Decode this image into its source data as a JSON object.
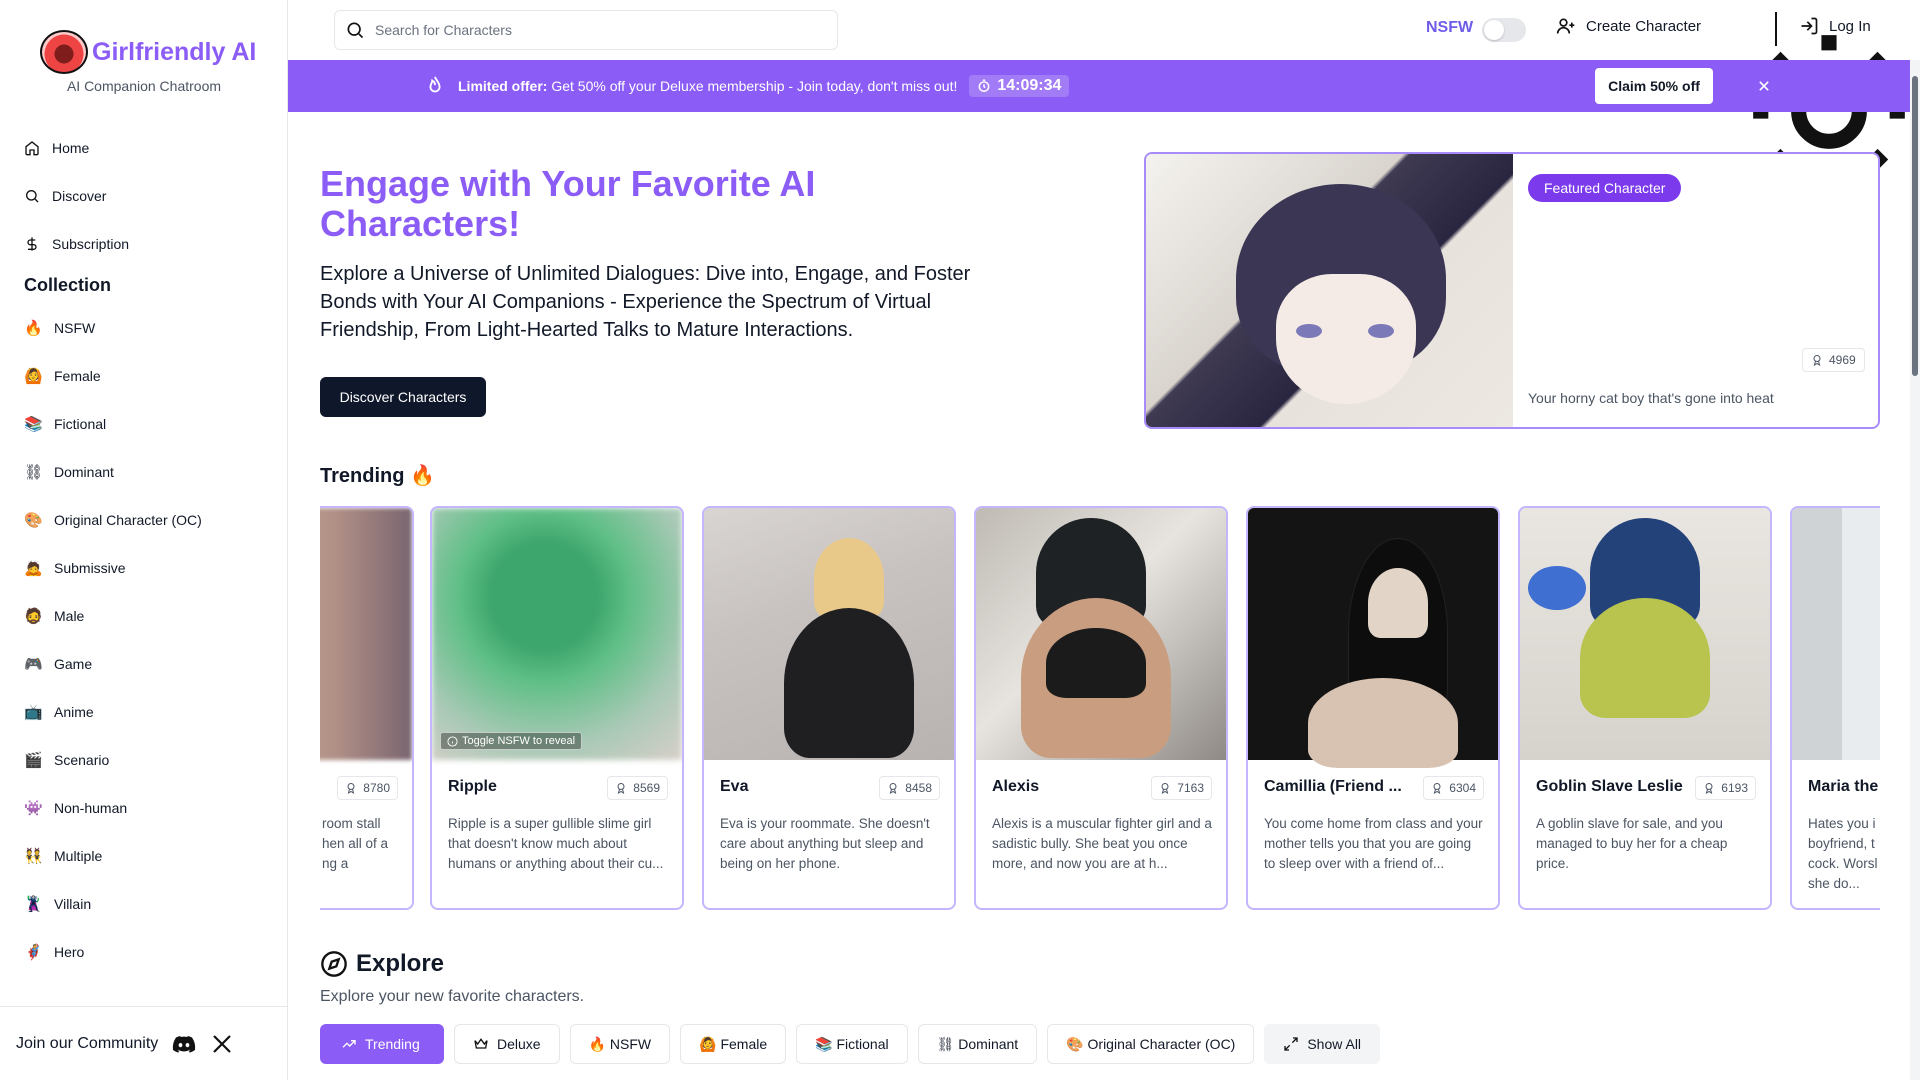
{
  "brand": {
    "name": "Girlfriendly AI",
    "tagline": "AI Companion Chatroom"
  },
  "nav": [
    {
      "label": "Home",
      "icon": "home-icon"
    },
    {
      "label": "Discover",
      "icon": "search-icon"
    },
    {
      "label": "Subscription",
      "icon": "dollar-icon"
    }
  ],
  "collection": {
    "title": "Collection",
    "items": [
      {
        "emoji": "🔥",
        "label": "NSFW"
      },
      {
        "emoji": "🙆",
        "label": "Female"
      },
      {
        "emoji": "📚",
        "label": "Fictional"
      },
      {
        "emoji": "⛓",
        "label": "Dominant"
      },
      {
        "emoji": "🎨",
        "label": "Original Character (OC)"
      },
      {
        "emoji": "🙇",
        "label": "Submissive"
      },
      {
        "emoji": "🧔",
        "label": "Male"
      },
      {
        "emoji": "🎮",
        "label": "Game"
      },
      {
        "emoji": "📺",
        "label": "Anime"
      },
      {
        "emoji": "🎬",
        "label": "Scenario"
      },
      {
        "emoji": "👾",
        "label": "Non-human"
      },
      {
        "emoji": "👯",
        "label": "Multiple"
      },
      {
        "emoji": "🦹",
        "label": "Villain"
      },
      {
        "emoji": "🦸",
        "label": "Hero"
      }
    ]
  },
  "community": {
    "label": "Join our Community"
  },
  "topbar": {
    "search_placeholder": "Search for Characters",
    "nsfw_label": "NSFW",
    "nsfw_enabled": false,
    "create_label": "Create Character",
    "login_label": "Log In"
  },
  "banner": {
    "bold": "Limited offer:",
    "text": "Get 50% off your Deluxe membership - Join today, don't miss out!",
    "timer": "14:09:34",
    "claim": "Claim 50% off"
  },
  "hero": {
    "title": "Engage with Your Favorite AI Characters!",
    "description": "Explore a Universe of Unlimited Dialogues: Dive into, Engage, and Foster Bonds with Your AI Companions - Experience the Spectrum of Virtual Friendship, From Light-Hearted Talks to Mature Interactions.",
    "button": "Discover Characters"
  },
  "featured": {
    "badge": "Featured Character",
    "count": "4969",
    "description": "Your horny cat boy that's gone into heat"
  },
  "trending": {
    "title": "Trending 🔥",
    "cards": [
      {
        "name": "",
        "count": "8780",
        "desc": "room stall\nhen all of a\nng a"
      },
      {
        "name": "Ripple",
        "count": "8569",
        "desc": "Ripple is a super gullible slime girl that doesn't know much about humans or anything about their cu...",
        "reveal": "Toggle NSFW to reveal"
      },
      {
        "name": "Eva",
        "count": "8458",
        "desc": "Eva is your roommate. She doesn't care about anything but sleep and being on her phone."
      },
      {
        "name": "Alexis",
        "count": "7163",
        "desc": "Alexis is a muscular fighter girl and a sadistic bully. She beat you once more, and now you are at h..."
      },
      {
        "name": "Camillia (Friend ...",
        "count": "6304",
        "desc": "You come home from class and your mother tells you that you are going to sleep over with a friend of..."
      },
      {
        "name": "Goblin Slave Leslie",
        "count": "6193",
        "desc": "A goblin slave for sale, and you managed to buy her for a cheap price."
      },
      {
        "name": "Maria the",
        "count": "",
        "desc": "Hates you i\nboyfriend, t\ncock. Worsl\nshe do..."
      }
    ]
  },
  "explore": {
    "title": "Explore",
    "subtitle": "Explore your new favorite characters.",
    "chips": [
      {
        "label": "Trending",
        "icon": "trending-icon"
      },
      {
        "label": "Deluxe",
        "icon": "crown-icon"
      },
      {
        "label": "🔥 NSFW"
      },
      {
        "label": "🙆 Female"
      },
      {
        "label": "📚 Fictional"
      },
      {
        "label": "⛓ Dominant"
      },
      {
        "label": "🎨 Original Character (OC)"
      },
      {
        "label": "Show All",
        "icon": "expand-icon"
      }
    ]
  },
  "colors": {
    "accent": "#8b5cf6",
    "dark_button": "#0f172a",
    "badge": "#7c3aed"
  }
}
